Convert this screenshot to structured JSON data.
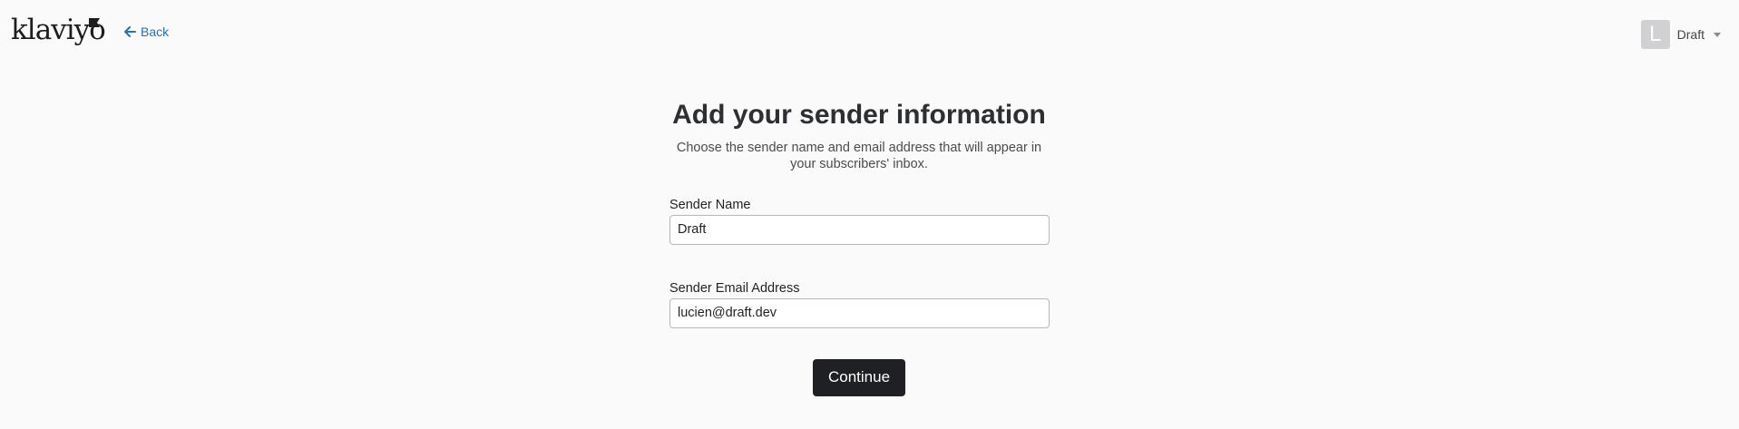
{
  "header": {
    "logo_text": "klaviyo",
    "back_label": "Back",
    "account": {
      "avatar_initial": "L",
      "name": "Draft"
    }
  },
  "main": {
    "title": "Add your sender information",
    "subtitle": "Choose the sender name and email address that will appear in your subscribers' inbox.",
    "fields": [
      {
        "label": "Sender Name",
        "value": "Draft"
      },
      {
        "label": "Sender Email Address",
        "value": "lucien@draft.dev"
      }
    ],
    "continue_label": "Continue"
  },
  "colors": {
    "link": "#2a6fb0",
    "button_bg": "#1f2023",
    "avatar_bg": "#d1d1d4"
  },
  "icons": {
    "back": "arrow-left-icon",
    "logo_mark": "flag-icon",
    "account_menu": "caret-down-icon"
  }
}
